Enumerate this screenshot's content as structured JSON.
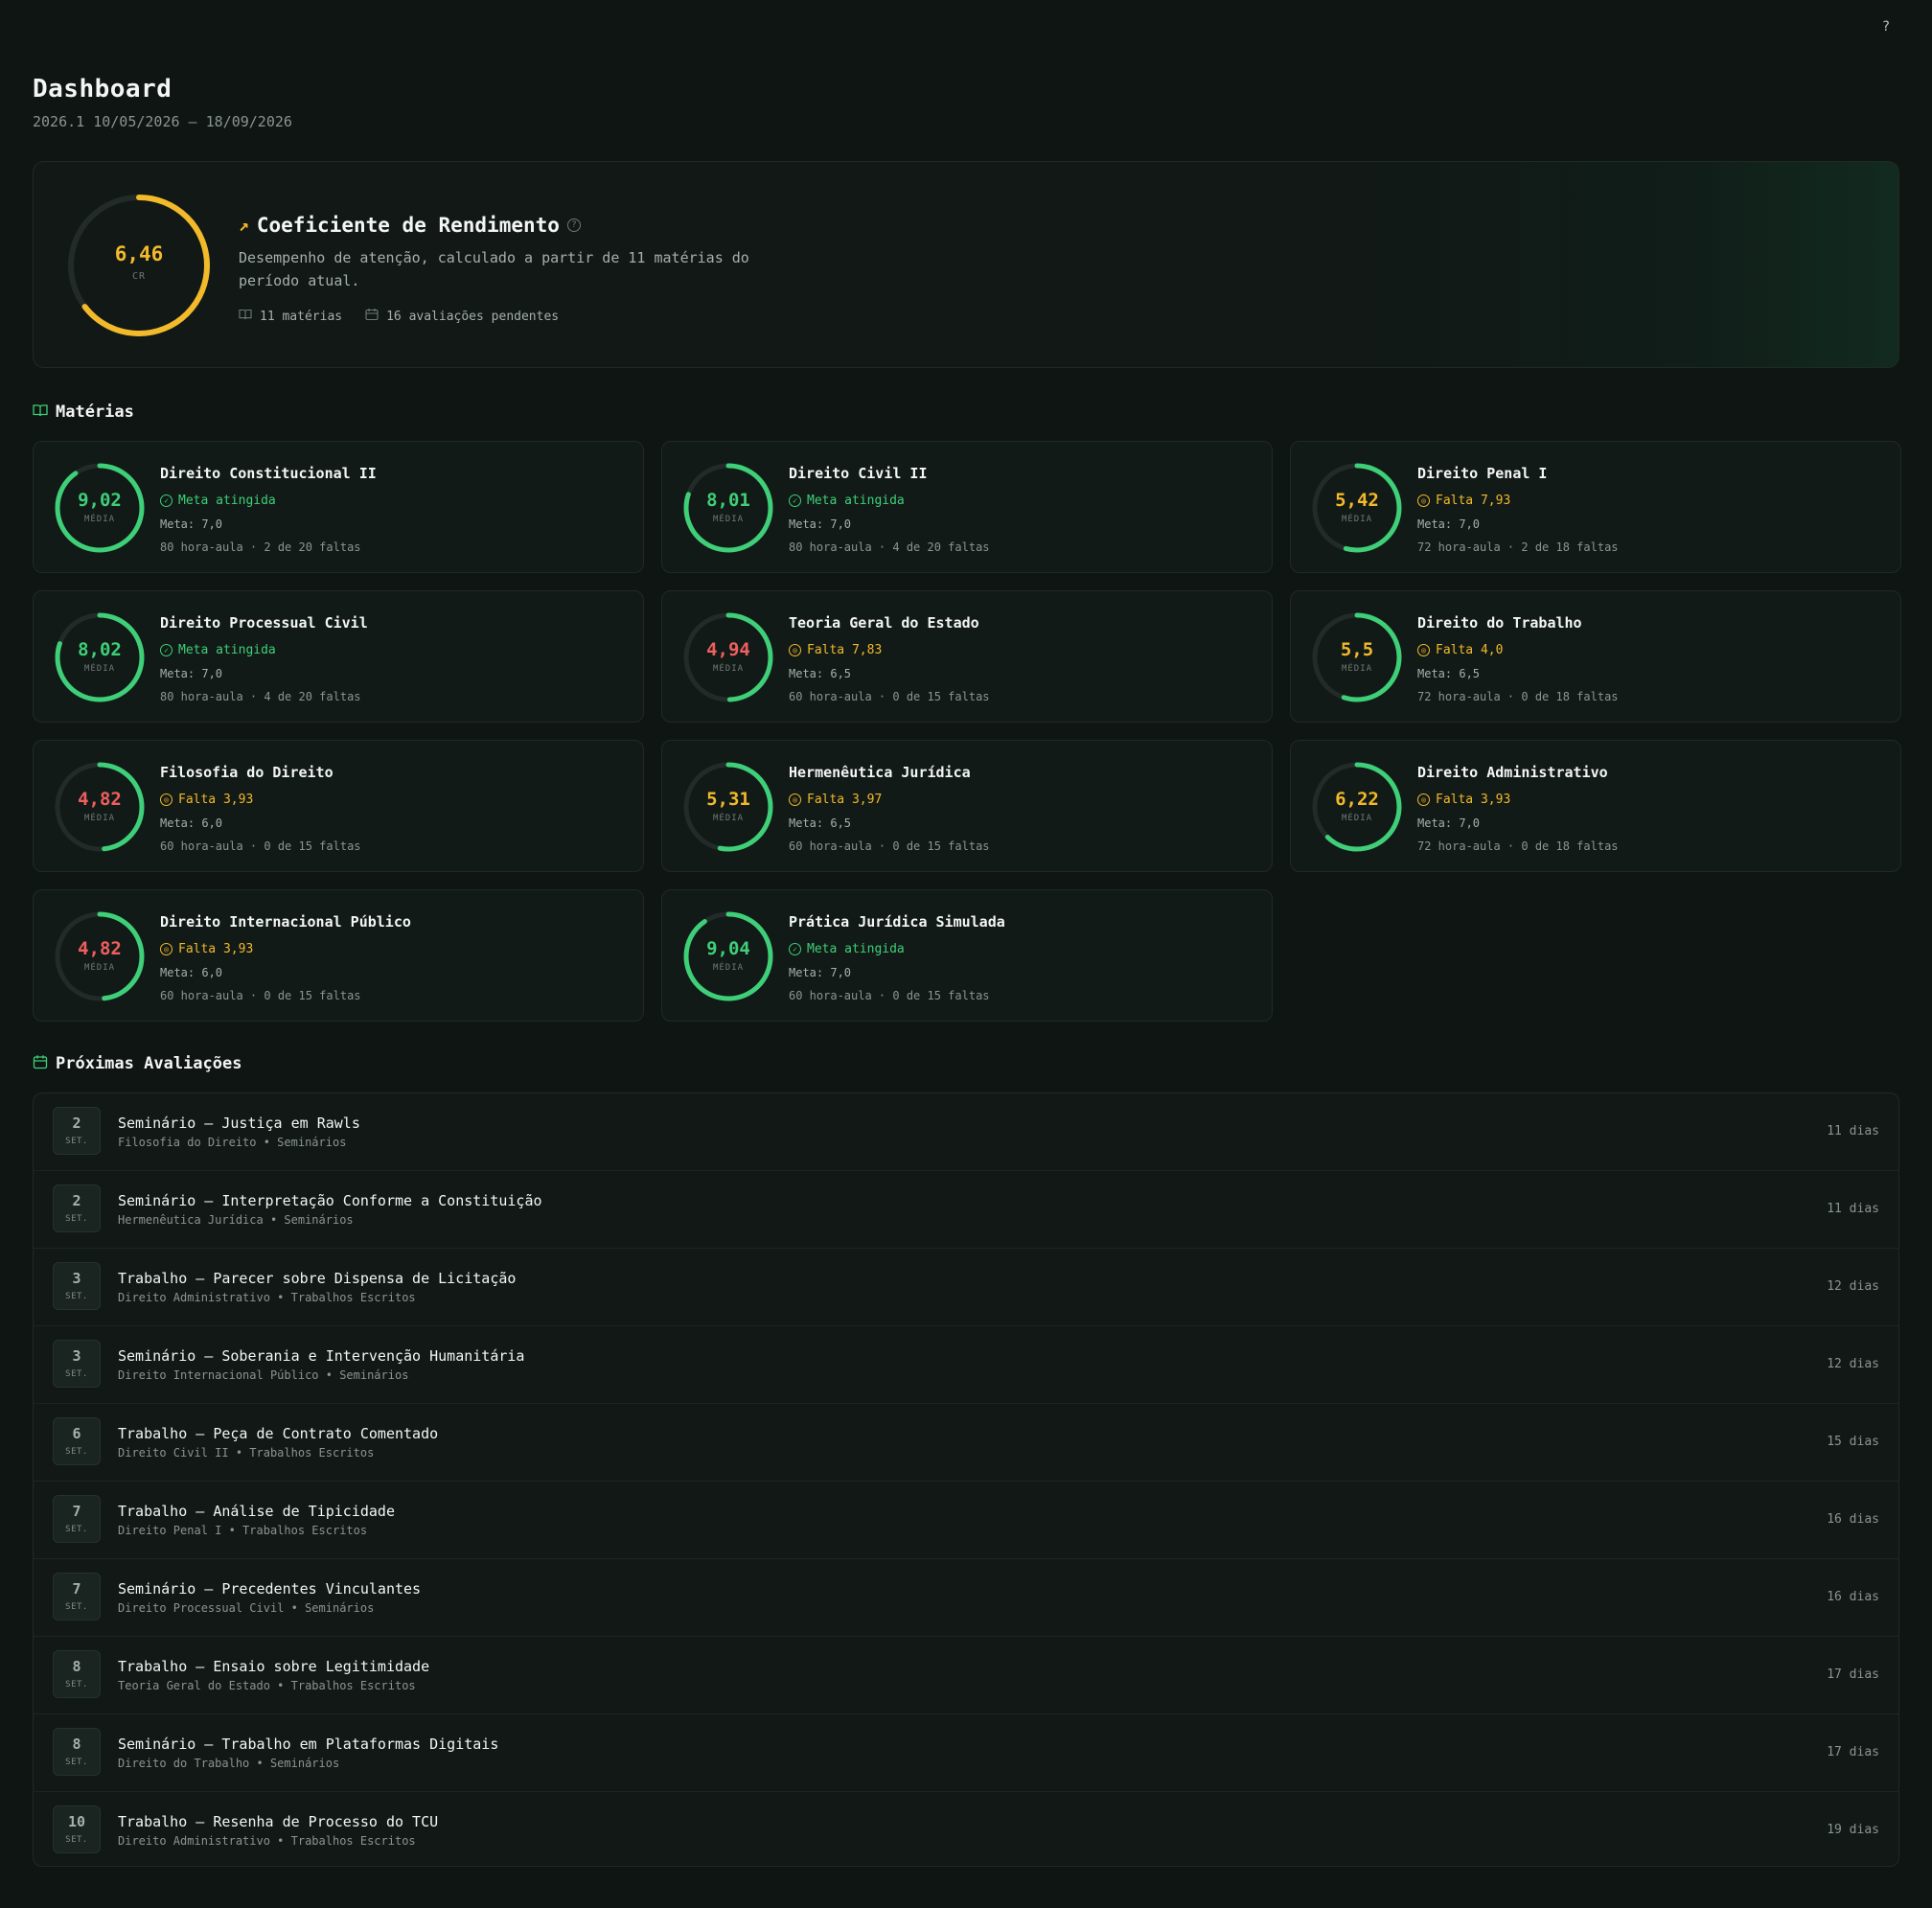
{
  "help_label": "?",
  "header": {
    "title": "Dashboard",
    "subtitle": "2026.1 10/05/2026 — 18/09/2026"
  },
  "cr": {
    "value_text": "6,46",
    "value": 6.46,
    "max": 10,
    "label": "CR",
    "title": "Coeficiente de Rendimento",
    "description": "Desempenho de atenção, calculado a partir de 11 matérias do período atual.",
    "subjects_count": "11 matérias",
    "pending": "16 avaliações pendentes",
    "color": "#f2b92a"
  },
  "subjects_section": {
    "title": "Matérias"
  },
  "subjects": [
    {
      "name": "Direito Constitucional II",
      "avg_text": "9,02",
      "avg": 9.02,
      "avg_color": "#3ecf78",
      "status": "Meta atingida",
      "status_type": "ok",
      "meta": "Meta: 7,0",
      "hours": "80 hora-aula · 2 de 20 faltas"
    },
    {
      "name": "Direito Civil II",
      "avg_text": "8,01",
      "avg": 8.01,
      "avg_color": "#3ecf78",
      "status": "Meta atingida",
      "status_type": "ok",
      "meta": "Meta: 7,0",
      "hours": "80 hora-aula · 4 de 20 faltas"
    },
    {
      "name": "Direito Penal I",
      "avg_text": "5,42",
      "avg": 5.42,
      "avg_color": "#f2b92a",
      "status": "Falta 7,93",
      "status_type": "warn",
      "meta": "Meta: 7,0",
      "hours": "72 hora-aula · 2 de 18 faltas"
    },
    {
      "name": "Direito Processual Civil",
      "avg_text": "8,02",
      "avg": 8.02,
      "avg_color": "#3ecf78",
      "status": "Meta atingida",
      "status_type": "ok",
      "meta": "Meta: 7,0",
      "hours": "80 hora-aula · 4 de 20 faltas"
    },
    {
      "name": "Teoria Geral do Estado",
      "avg_text": "4,94",
      "avg": 4.94,
      "avg_color": "#ef5f5f",
      "status": "Falta 7,83",
      "status_type": "warn",
      "meta": "Meta: 6,5",
      "hours": "60 hora-aula · 0 de 15 faltas"
    },
    {
      "name": "Direito do Trabalho",
      "avg_text": "5,5",
      "avg": 5.5,
      "avg_color": "#f2b92a",
      "status": "Falta 4,0",
      "status_type": "warn",
      "meta": "Meta: 6,5",
      "hours": "72 hora-aula · 0 de 18 faltas"
    },
    {
      "name": "Filosofia do Direito",
      "avg_text": "4,82",
      "avg": 4.82,
      "avg_color": "#ef5f5f",
      "status": "Falta 3,93",
      "status_type": "warn",
      "meta": "Meta: 6,0",
      "hours": "60 hora-aula · 0 de 15 faltas"
    },
    {
      "name": "Hermenêutica Jurídica",
      "avg_text": "5,31",
      "avg": 5.31,
      "avg_color": "#f2b92a",
      "status": "Falta 3,97",
      "status_type": "warn",
      "meta": "Meta: 6,5",
      "hours": "60 hora-aula · 0 de 15 faltas"
    },
    {
      "name": "Direito Administrativo",
      "avg_text": "6,22",
      "avg": 6.22,
      "avg_color": "#f2b92a",
      "status": "Falta 3,93",
      "status_type": "warn",
      "meta": "Meta: 7,0",
      "hours": "72 hora-aula · 0 de 18 faltas"
    },
    {
      "name": "Direito Internacional Público",
      "avg_text": "4,82",
      "avg": 4.82,
      "avg_color": "#ef5f5f",
      "status": "Falta 3,93",
      "status_type": "warn",
      "meta": "Meta: 6,0",
      "hours": "60 hora-aula · 0 de 15 faltas"
    },
    {
      "name": "Prática Jurídica Simulada",
      "avg_text": "9,04",
      "avg": 9.04,
      "avg_color": "#3ecf78",
      "status": "Meta atingida",
      "status_type": "ok",
      "meta": "Meta: 7,0",
      "hours": "60 hora-aula · 0 de 15 faltas"
    }
  ],
  "subject_ring_label": "MÉDIA",
  "assessments_section": {
    "title": "Próximas Avaliações"
  },
  "assessments": [
    {
      "day": "2",
      "month": "SET.",
      "title": "Seminário — Justiça em Rawls",
      "sub": "Filosofia do Direito • Seminários",
      "days": "11 dias"
    },
    {
      "day": "2",
      "month": "SET.",
      "title": "Seminário — Interpretação Conforme a Constituição",
      "sub": "Hermenêutica Jurídica • Seminários",
      "days": "11 dias"
    },
    {
      "day": "3",
      "month": "SET.",
      "title": "Trabalho — Parecer sobre Dispensa de Licitação",
      "sub": "Direito Administrativo • Trabalhos Escritos",
      "days": "12 dias"
    },
    {
      "day": "3",
      "month": "SET.",
      "title": "Seminário — Soberania e Intervenção Humanitária",
      "sub": "Direito Internacional Público • Seminários",
      "days": "12 dias"
    },
    {
      "day": "6",
      "month": "SET.",
      "title": "Trabalho — Peça de Contrato Comentado",
      "sub": "Direito Civil II • Trabalhos Escritos",
      "days": "15 dias"
    },
    {
      "day": "7",
      "month": "SET.",
      "title": "Trabalho — Análise de Tipicidade",
      "sub": "Direito Penal I • Trabalhos Escritos",
      "days": "16 dias"
    },
    {
      "day": "7",
      "month": "SET.",
      "title": "Seminário — Precedentes Vinculantes",
      "sub": "Direito Processual Civil • Seminários",
      "days": "16 dias"
    },
    {
      "day": "8",
      "month": "SET.",
      "title": "Trabalho — Ensaio sobre Legitimidade",
      "sub": "Teoria Geral do Estado • Trabalhos Escritos",
      "days": "17 dias"
    },
    {
      "day": "8",
      "month": "SET.",
      "title": "Seminário — Trabalho em Plataformas Digitais",
      "sub": "Direito do Trabalho • Seminários",
      "days": "17 dias"
    },
    {
      "day": "10",
      "month": "SET.",
      "title": "Trabalho — Resenha de Processo do TCU",
      "sub": "Direito Administrativo • Trabalhos Escritos",
      "days": "19 dias"
    }
  ],
  "colors": {
    "ok": "#3ecf78",
    "warn": "#f2b92a",
    "ring_track": "#222b27"
  }
}
